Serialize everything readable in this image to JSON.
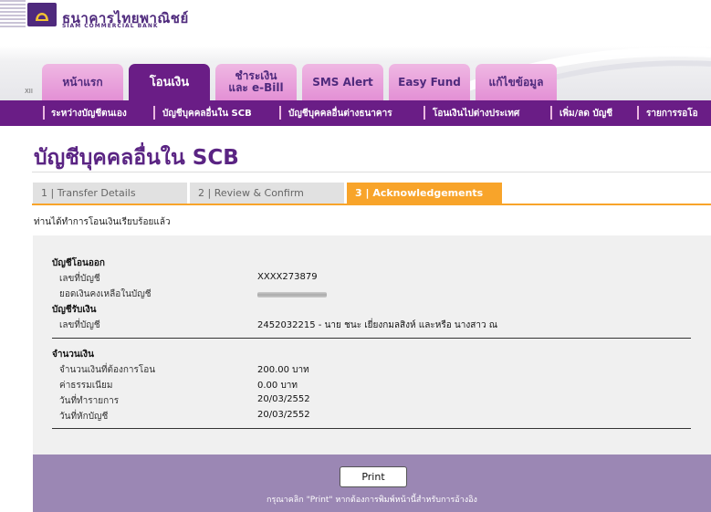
{
  "header": {
    "bank_name_th": "ธนาคารไทยพาณิชย์",
    "bank_name_en": "SIAM COMMERCIAL BANK",
    "small_label": "XII"
  },
  "tabs": [
    {
      "label": "หน้าแรก",
      "active": false
    },
    {
      "label": "โอนเงิน",
      "active": true
    },
    {
      "label_line1": "ชำระเงิน",
      "label_line2": "และ e-Bill",
      "active": false
    },
    {
      "label": "SMS Alert",
      "active": false
    },
    {
      "label": "Easy Fund",
      "active": false
    },
    {
      "label": "แก้ไขข้อมูล",
      "active": false
    }
  ],
  "subnav": [
    "ระหว่างบัญชีตนเอง",
    "บัญชีบุคคลอื่นใน SCB",
    "บัญชีบุคคลอื่นต่างธนาคาร",
    "โอนเงินไปต่างประเทศ",
    "เพิ่ม/ลด บัญชี",
    "รายการรอโอ"
  ],
  "page_title": "บัญชีบุคคลอื่นใน SCB",
  "steps": [
    {
      "label": "1 | Transfer Details",
      "state": "done"
    },
    {
      "label": "2 | Review & Confirm",
      "state": "done"
    },
    {
      "label": "3 | Acknowledgements",
      "state": "current"
    }
  ],
  "success_message": "ท่านได้ทำการโอนเงินเรียบร้อยแล้ว",
  "from_account": {
    "section_label": "บัญชีโอนออก",
    "account_no_label": "เลขที่บัญชี",
    "account_no": "XXXX273879",
    "balance_label": "ยอดเงินคงเหลือในบัญชี"
  },
  "to_account": {
    "section_label": "บัญชีรับเงิน",
    "account_no_label": "เลขที่บัญชี",
    "account_no": "2452032215 - นาย ชนะ เยี่ยงกมลสิงห์ และหรือ นางสาว ณ"
  },
  "amount": {
    "section_label": "จำนวนเงิน",
    "rows": [
      {
        "label": "จำนวนเงินที่ต้องการโอน",
        "value": "200.00 บาท"
      },
      {
        "label": "ค่าธรรมเนียม",
        "value": "0.00 บาท"
      },
      {
        "label": "วันที่ทำรายการ",
        "value": "20/03/2552"
      },
      {
        "label": "วันที่หักบัญชี",
        "value": "20/03/2552"
      }
    ]
  },
  "print_button": "Print",
  "footer_note": "กรุณาคลิก \"Print\" หากต้องการพิมพ์หน้านี้สำหรับการอ้างอิง",
  "colors": {
    "brand_purple": "#6a1d86",
    "tab_pink": "#e390d5",
    "step_orange": "#f8a42a",
    "footer_lavender": "#9b87b4"
  }
}
